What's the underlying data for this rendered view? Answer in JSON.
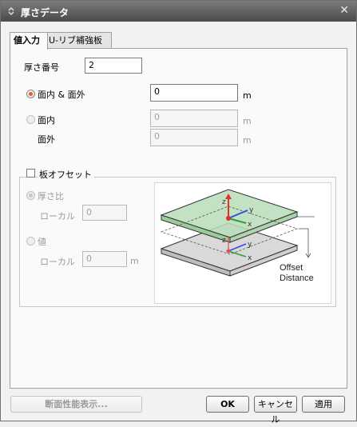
{
  "window": {
    "title": "厚さデータ",
    "close_glyph": "✕"
  },
  "tabs": [
    {
      "label": "値入力",
      "active": true
    },
    {
      "label": "U-リブ補強板",
      "active": false
    }
  ],
  "thickness_no": {
    "label": "厚さ番号",
    "value": "2"
  },
  "inplane_outplane": {
    "label": "面内 & 面外",
    "value": "0",
    "unit": "m",
    "selected": true
  },
  "inplane": {
    "label": "面内",
    "value": "0",
    "unit": "m",
    "selected": false
  },
  "outplane": {
    "label": "面外",
    "value": "0",
    "unit": "m"
  },
  "plate_offset": {
    "label": "板オフセット",
    "checked": false,
    "ratio": {
      "label": "厚さ比",
      "local_label": "ローカル",
      "value": "0",
      "selected": true
    },
    "value_opt": {
      "label": "値",
      "local_label": "ローカル",
      "value": "0",
      "unit": "m",
      "selected": false
    }
  },
  "diagram": {
    "axis_z": "z",
    "axis_y": "y",
    "axis_x": "x",
    "axis_z2": "z",
    "axis_y2": "y",
    "axis_x2": "x",
    "offset_text_line1": "Offset",
    "offset_text_line2": "Distance"
  },
  "buttons": {
    "section_props": "断面性能表示...",
    "ok": "OK",
    "cancel": "キャンセル",
    "apply": "適用"
  },
  "colors": {
    "radio_selected": "#e2602e",
    "plate_top": "#b9dcb9",
    "plate_bottom": "#d9d9d9",
    "axis_z": "#e03030",
    "axis_y": "#3050e0",
    "axis_x": "#30a030"
  }
}
